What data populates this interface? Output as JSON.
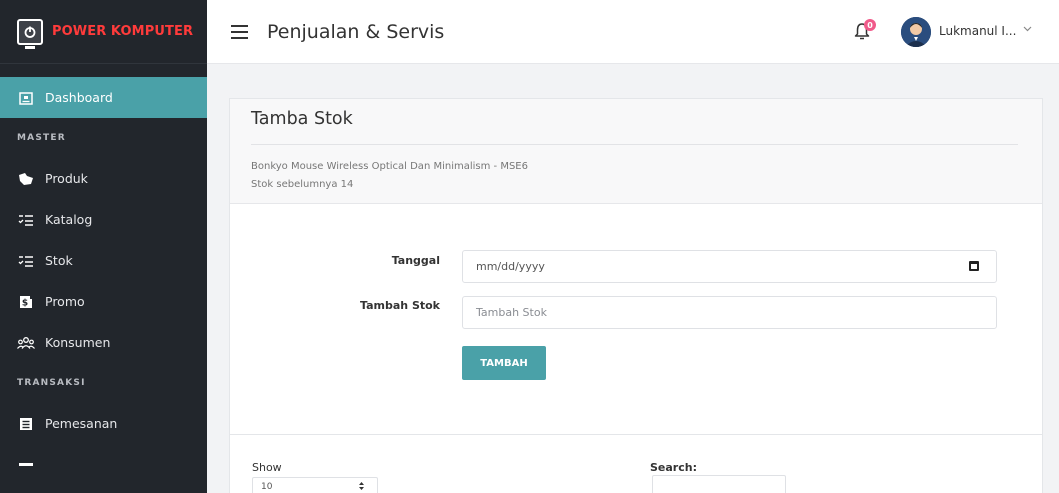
{
  "brand": {
    "name": "POWER KOMPUTER",
    "name_color": "#ff3b3b"
  },
  "sidebar": {
    "active": {
      "label": "Dashboard",
      "icon": "dashboard-icon"
    },
    "sections": [
      {
        "heading": "MASTER"
      },
      {
        "heading": "TRANSAKSI"
      }
    ],
    "items": [
      {
        "label": "Produk",
        "icon": "product-icon"
      },
      {
        "label": "Katalog",
        "icon": "checklist-icon"
      },
      {
        "label": "Stok",
        "icon": "checklist-icon"
      },
      {
        "label": "Promo",
        "icon": "dollar-icon"
      },
      {
        "label": "Konsumen",
        "icon": "users-icon"
      },
      {
        "label": "Pemesanan",
        "icon": "document-icon"
      }
    ],
    "accent": "#4aa1a8",
    "background": "#22262c"
  },
  "topbar": {
    "title": "Penjualan & Servis",
    "notif_count": "0",
    "user_name": "Lukmanul I..."
  },
  "card": {
    "title": "Tamba Stok",
    "product": "Bonkyo Mouse Wireless Optical Dan Minimalism - MSE6",
    "previous_stock": "Stok sebelumnya 14",
    "form": {
      "date_label": "Tanggal",
      "date_value": "mm/dd/yyyy",
      "stock_label": "Tambah Stok",
      "stock_placeholder": "Tambah Stok",
      "submit_label": "TAMBAH"
    }
  },
  "table": {
    "show_label": "Show",
    "show_value": "10",
    "search_label": "Search:"
  }
}
